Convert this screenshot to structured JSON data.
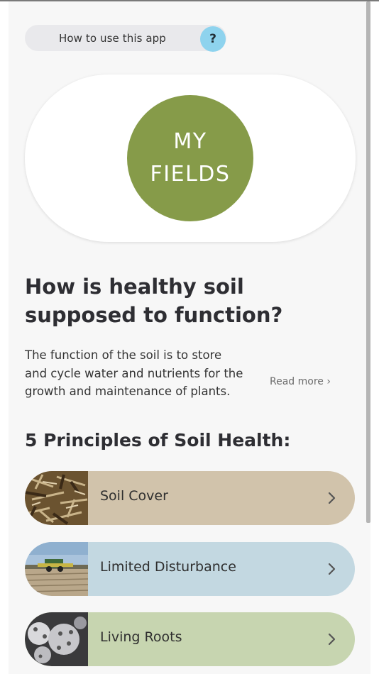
{
  "help": {
    "label": "How to use this app",
    "icon": "?"
  },
  "fields": {
    "line1": "MY",
    "line2": "FIELDS",
    "color": "#869b49"
  },
  "intro": {
    "heading": "How is healthy soil supposed to function?",
    "description": "The function of the soil is to store and cycle water and nutrients for the growth and maintenance of plants.",
    "read_more": "Read more ›"
  },
  "principles": {
    "heading": "5 Principles of Soil Health:",
    "items": [
      {
        "label": "Soil Cover",
        "color": "#d1c3ab",
        "icon": "mulch-photo"
      },
      {
        "label": "Limited Disturbance",
        "color": "#c3d8e1",
        "icon": "field-planter-photo"
      },
      {
        "label": "Living Roots",
        "color": "#c7d5b0",
        "icon": "frosted-plant-photo"
      }
    ]
  }
}
